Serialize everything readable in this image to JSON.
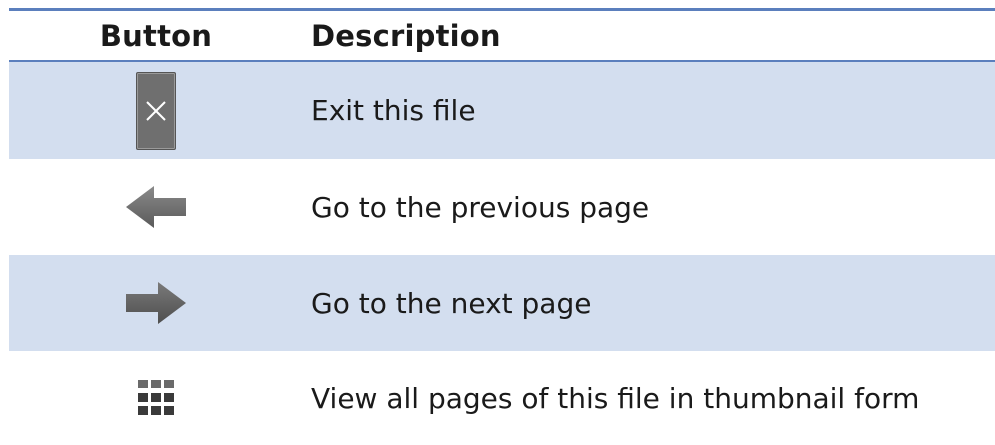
{
  "header": {
    "button_col": "Button",
    "description_col": "Description"
  },
  "rows": [
    {
      "icon": "close-icon",
      "description": "Exit this file"
    },
    {
      "icon": "arrow-left-icon",
      "description": "Go to the previous page"
    },
    {
      "icon": "arrow-right-icon",
      "description": "Go to the next page"
    },
    {
      "icon": "thumbnail-grid-icon",
      "description": "View all pages of this file in thumbnail form"
    }
  ],
  "colors": {
    "rule": "#5b7fbd",
    "shaded_row": "#d3deef",
    "icon_gray": "#6f6f6f"
  }
}
